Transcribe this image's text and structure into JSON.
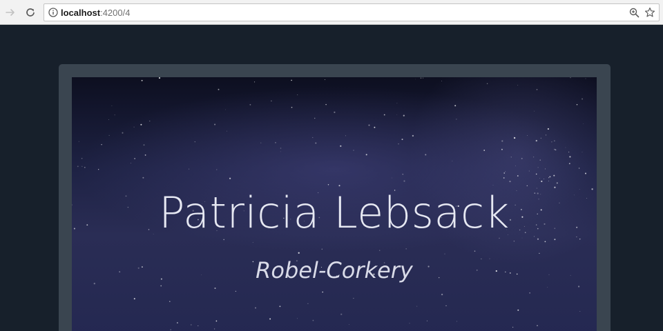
{
  "browser": {
    "url_host": "localhost",
    "url_rest": ":4200/4",
    "icons": {
      "forward": "arrow-right-icon",
      "reload": "reload-icon",
      "info": "info-icon",
      "zoom": "zoom-icon",
      "bookmark": "star-icon"
    }
  },
  "profile": {
    "name": "Patricia Lebsack",
    "company": "Robel-Corkery"
  },
  "colors": {
    "page_background": "#17202b",
    "card_frame": "#3a4550",
    "sky_top": "#0d0f20",
    "sky_bottom": "#242851",
    "text": "#e6e8f2"
  }
}
